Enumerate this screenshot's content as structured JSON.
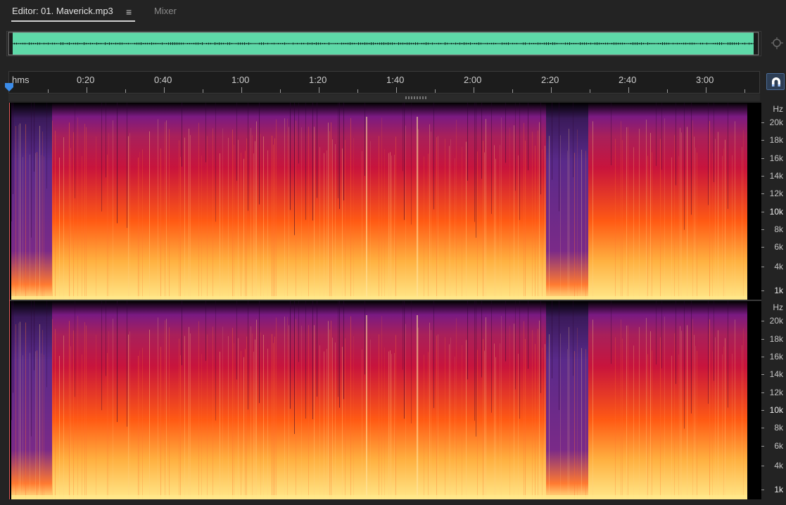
{
  "tabs": {
    "editor_label": "Editor: 01. Maverick.mp3",
    "menu_glyph": "≡",
    "mixer_label": "Mixer"
  },
  "overview": {
    "waveform_color": "#5ed9a8",
    "icons": {
      "zoom": "zoom-magnifier-icon"
    }
  },
  "timeline": {
    "unit_label": "hms",
    "labels": [
      "0:20",
      "0:40",
      "1:00",
      "1:20",
      "1:40",
      "2:00",
      "2:20",
      "2:40",
      "3:00"
    ],
    "snap_icon": "magnet-icon"
  },
  "spectral": {
    "channel_1": {
      "axis_unit": "Hz",
      "labels": [
        "20k",
        "18k",
        "16k",
        "14k",
        "12k",
        "10k",
        "8k",
        "6k",
        "4k",
        "1k"
      ]
    },
    "channel_2": {
      "axis_unit": "Hz",
      "labels": [
        "20k",
        "18k",
        "16k",
        "14k",
        "12k",
        "10k",
        "8k",
        "6k",
        "4k",
        "1k"
      ]
    },
    "colors": {
      "low": "#ffe88a",
      "mid": "#ff5a14",
      "high": "#c8143c",
      "top": "#7a1a82",
      "bg": "#000000"
    }
  }
}
